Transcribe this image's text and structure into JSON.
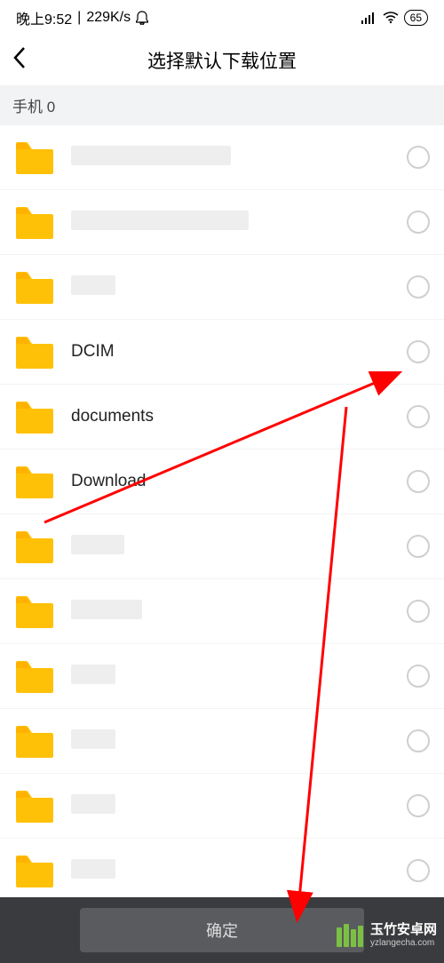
{
  "status": {
    "time": "晚上9:52",
    "speed": "229K/s",
    "battery": "65"
  },
  "header": {
    "title": "选择默认下载位置"
  },
  "breadcrumb": {
    "path": "手机  0"
  },
  "folders": [
    {
      "name": "",
      "blurred": true,
      "blur_width": 180
    },
    {
      "name": "",
      "blurred": true,
      "blur_width": 200
    },
    {
      "name": "",
      "blurred": true,
      "blur_width": 40
    },
    {
      "name": "DCIM",
      "blurred": false
    },
    {
      "name": "documents",
      "blurred": false
    },
    {
      "name": "Download",
      "blurred": false
    },
    {
      "name": "",
      "blurred": true,
      "blur_width": 60
    },
    {
      "name": "",
      "blurred": true,
      "blur_width": 80
    },
    {
      "name": "",
      "blurred": true,
      "blur_width": 30
    },
    {
      "name": "",
      "blurred": true,
      "blur_width": 35
    },
    {
      "name": "",
      "blurred": true,
      "blur_width": 30
    },
    {
      "name": "",
      "blurred": true,
      "blur_width": 50
    }
  ],
  "bottom": {
    "confirm": "确定"
  },
  "watermark": {
    "title": "玉竹安卓网",
    "url": "yzlangecha.com"
  }
}
